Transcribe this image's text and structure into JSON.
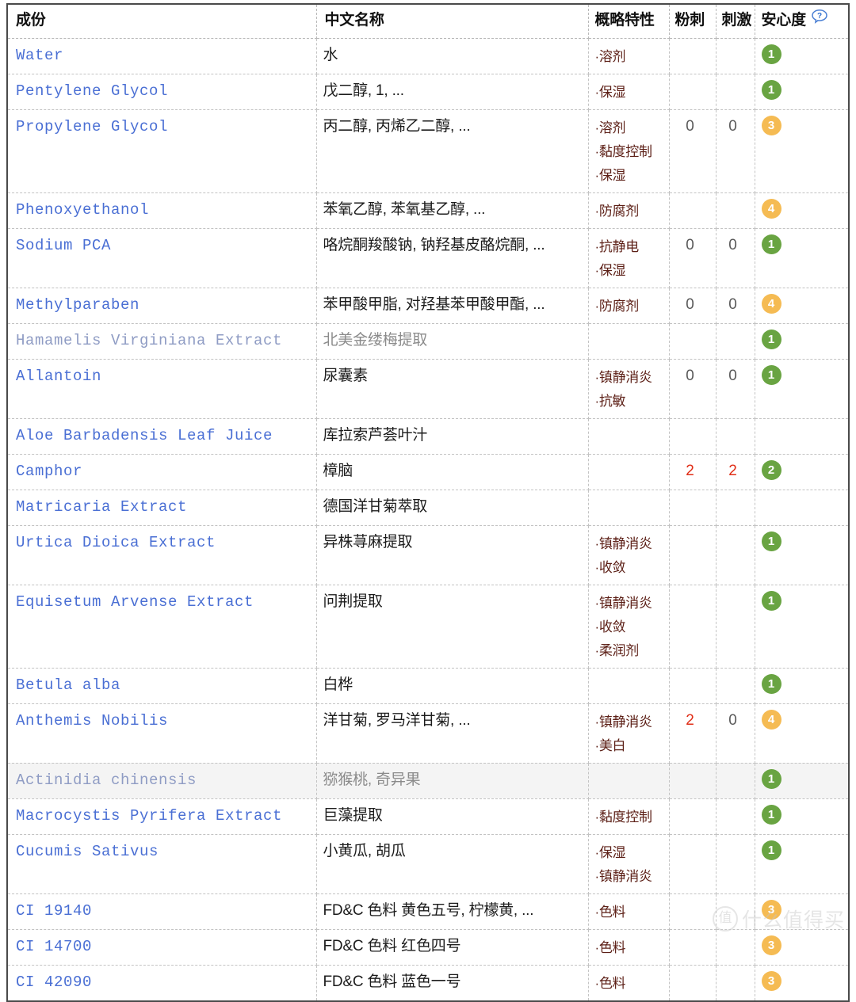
{
  "table": {
    "headers": {
      "name": "成份",
      "chinese_name": "中文名称",
      "features": "概略特性",
      "acne": "粉刺",
      "irritation": "刺激",
      "safety": "安心度",
      "help_icon": "question-bubble-icon"
    },
    "colors": {
      "link": "#4a6fd4",
      "feature_text": "#5c1f16",
      "badge_green": "#69a442",
      "badge_orange": "#f5bb53",
      "number_hot": "#e02e17",
      "number_normal": "#5a5a5a"
    },
    "rows": [
      {
        "name": "Water",
        "chinese_name": "水",
        "features": [
          "·溶剂"
        ],
        "acne": "",
        "irritation": "",
        "safety": "1",
        "safety_level": "green",
        "muted": false,
        "highlight": false
      },
      {
        "name": "Pentylene Glycol",
        "chinese_name": "戊二醇, 1, ...",
        "features": [
          "·保湿"
        ],
        "acne": "",
        "irritation": "",
        "safety": "1",
        "safety_level": "green",
        "muted": false,
        "highlight": false
      },
      {
        "name": "Propylene Glycol",
        "chinese_name": "丙二醇, 丙烯乙二醇, ...",
        "features": [
          "·溶剂",
          "·黏度控制",
          "·保湿"
        ],
        "acne": "0",
        "irritation": "0",
        "safety": "3",
        "safety_level": "orange",
        "muted": false,
        "highlight": false
      },
      {
        "name": "Phenoxyethanol",
        "chinese_name": "苯氧乙醇, 苯氧基乙醇, ...",
        "features": [
          "·防腐剂"
        ],
        "acne": "",
        "irritation": "",
        "safety": "4",
        "safety_level": "orange",
        "muted": false,
        "highlight": false
      },
      {
        "name": "Sodium PCA",
        "chinese_name": "咯烷酮羧酸钠, 钠羟基皮酪烷酮, ...",
        "features": [
          "·抗静电",
          "·保湿"
        ],
        "acne": "0",
        "irritation": "0",
        "safety": "1",
        "safety_level": "green",
        "muted": false,
        "highlight": false
      },
      {
        "name": "Methylparaben",
        "chinese_name": "苯甲酸甲脂, 对羟基苯甲酸甲酯, ...",
        "features": [
          "·防腐剂"
        ],
        "acne": "0",
        "irritation": "0",
        "safety": "4",
        "safety_level": "orange",
        "muted": false,
        "highlight": false
      },
      {
        "name": "Hamamelis Virginiana Extract",
        "chinese_name": "北美金缕梅提取",
        "features": [],
        "acne": "",
        "irritation": "",
        "safety": "1",
        "safety_level": "green",
        "muted": true,
        "highlight": false
      },
      {
        "name": "Allantoin",
        "chinese_name": "尿囊素",
        "features": [
          "·镇静消炎",
          "·抗敏"
        ],
        "acne": "0",
        "irritation": "0",
        "safety": "1",
        "safety_level": "green",
        "muted": false,
        "highlight": false
      },
      {
        "name": "Aloe Barbadensis Leaf Juice",
        "chinese_name": "库拉索芦荟叶汁",
        "features": [],
        "acne": "",
        "irritation": "",
        "safety": "",
        "safety_level": "",
        "muted": false,
        "highlight": false
      },
      {
        "name": "Camphor",
        "chinese_name": "樟脑",
        "features": [],
        "acne": "2",
        "irritation": "2",
        "safety": "2",
        "safety_level": "green",
        "muted": false,
        "highlight": false,
        "acne_hot": true,
        "irritation_hot": true
      },
      {
        "name": "Matricaria Extract",
        "chinese_name": "德国洋甘菊萃取",
        "features": [],
        "acne": "",
        "irritation": "",
        "safety": "",
        "safety_level": "",
        "muted": false,
        "highlight": false
      },
      {
        "name": "Urtica Dioica Extract",
        "chinese_name": "异株荨麻提取",
        "features": [
          "·镇静消炎",
          "·收敛"
        ],
        "acne": "",
        "irritation": "",
        "safety": "1",
        "safety_level": "green",
        "muted": false,
        "highlight": false
      },
      {
        "name": "Equisetum Arvense Extract",
        "chinese_name": "问荆提取",
        "features": [
          "·镇静消炎",
          "·收敛",
          "·柔润剂"
        ],
        "acne": "",
        "irritation": "",
        "safety": "1",
        "safety_level": "green",
        "muted": false,
        "highlight": false
      },
      {
        "name": "Betula alba",
        "chinese_name": "白桦",
        "features": [],
        "acne": "",
        "irritation": "",
        "safety": "1",
        "safety_level": "green",
        "muted": false,
        "highlight": false
      },
      {
        "name": "Anthemis Nobilis",
        "chinese_name": "洋甘菊, 罗马洋甘菊, ...",
        "features": [
          "·镇静消炎",
          "·美白"
        ],
        "acne": "2",
        "irritation": "0",
        "safety": "4",
        "safety_level": "orange",
        "muted": false,
        "highlight": false,
        "acne_hot": true
      },
      {
        "name": "Actinidia chinensis",
        "chinese_name": "猕猴桃, 奇异果",
        "features": [],
        "acne": "",
        "irritation": "",
        "safety": "1",
        "safety_level": "green",
        "muted": true,
        "highlight": true
      },
      {
        "name": "Macrocystis Pyrifera Extract",
        "chinese_name": "巨藻提取",
        "features": [
          "·黏度控制"
        ],
        "acne": "",
        "irritation": "",
        "safety": "1",
        "safety_level": "green",
        "muted": false,
        "highlight": false
      },
      {
        "name": "Cucumis Sativus",
        "chinese_name": "小黄瓜, 胡瓜",
        "features": [
          "·保湿",
          "·镇静消炎"
        ],
        "acne": "",
        "irritation": "",
        "safety": "1",
        "safety_level": "green",
        "muted": false,
        "highlight": false
      },
      {
        "name": "CI 19140",
        "chinese_name": "FD&C 色料 黄色五号, 柠檬黄, ...",
        "features": [
          "·色料"
        ],
        "acne": "",
        "irritation": "",
        "safety": "3",
        "safety_level": "orange",
        "muted": false,
        "highlight": false
      },
      {
        "name": "CI 14700",
        "chinese_name": "FD&C 色料 红色四号",
        "features": [
          "·色料"
        ],
        "acne": "",
        "irritation": "",
        "safety": "3",
        "safety_level": "orange",
        "muted": false,
        "highlight": false
      },
      {
        "name": "CI 42090",
        "chinese_name": "FD&C 色料 蓝色一号",
        "features": [
          "·色料"
        ],
        "acne": "",
        "irritation": "",
        "safety": "3",
        "safety_level": "orange",
        "muted": false,
        "highlight": false
      }
    ]
  },
  "watermark": {
    "logo_text": "值",
    "text": "什么值得买"
  }
}
